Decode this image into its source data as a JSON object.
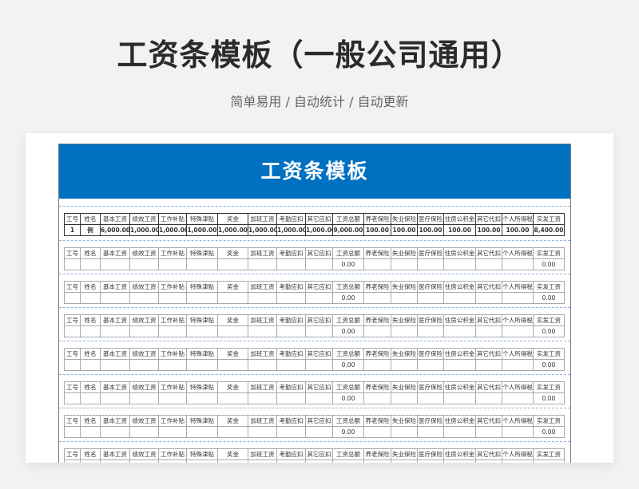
{
  "title": "工资条模板（一般公司通用）",
  "subtitle": "简单易用 / 自动统计 / 自动更新",
  "sheet": {
    "banner": "工资条模板",
    "accent_color": "#0070c0",
    "headers": [
      "工号",
      "姓名",
      "基本工资",
      "绩效工资",
      "工作补贴",
      "特殊津贴",
      "奖金",
      "加班工资",
      "考勤应扣",
      "其它应扣",
      "工资总额",
      "养老保险",
      "失业保险",
      "医疗保险",
      "住房公积金",
      "其它代扣",
      "个人所得税",
      "实发工资"
    ],
    "example_row": [
      "1",
      "例",
      "6,000.00",
      "1,000.00",
      "1,000.00",
      "1,000.00",
      "1,000.00",
      "1,000.00",
      "1,000.00",
      "1,000.00",
      "9,000.00",
      "100.00",
      "100.00",
      "100.00",
      "100.00",
      "100.00",
      "100.00",
      "8,400.00"
    ],
    "empty_row": [
      "",
      "",
      "",
      "",
      "",
      "",
      "",
      "",
      "",
      "",
      "0.00",
      "",
      "",
      "",
      "",
      "",
      "",
      "0.00"
    ],
    "empty_block_count": 7
  }
}
